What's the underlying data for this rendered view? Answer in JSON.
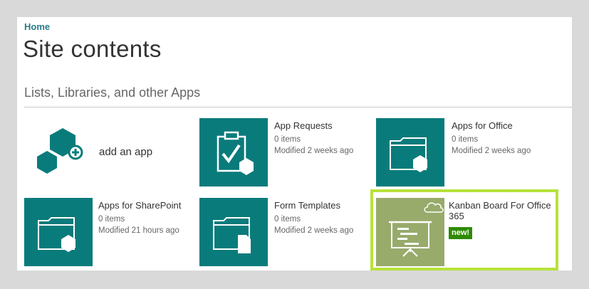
{
  "breadcrumb": {
    "home": "Home"
  },
  "page": {
    "title": "Site contents"
  },
  "section": {
    "header": "Lists, Libraries, and other Apps"
  },
  "add_app": {
    "label": "add an app"
  },
  "apps": [
    {
      "title": "App Requests",
      "count": "0 items",
      "modified": "Modified 2 weeks ago"
    },
    {
      "title": "Apps for Office",
      "count": "0 items",
      "modified": "Modified 2 weeks ago"
    },
    {
      "title": "Apps for SharePoint",
      "count": "0 items",
      "modified": "Modified 21 hours ago"
    },
    {
      "title": "Form Templates",
      "count": "0 items",
      "modified": "Modified 2 weeks ago"
    },
    {
      "title_line1": "Kanban Board For Office",
      "title_line2": "365",
      "badge": "new!"
    }
  ],
  "icons": {
    "add_app": "add-app-icon",
    "app_requests": "clipboard-check-icon",
    "folder": "folder-icon",
    "form_templates": "folder-document-icon",
    "kanban": "presentation-board-icon",
    "cloud": "cloud-icon"
  },
  "colors": {
    "tile": "#0a7b7b",
    "kanban_tile": "#98ab6b",
    "highlight": "#b7e23a",
    "badge": "#2e8b00",
    "breadcrumb": "#2a7a8a"
  }
}
